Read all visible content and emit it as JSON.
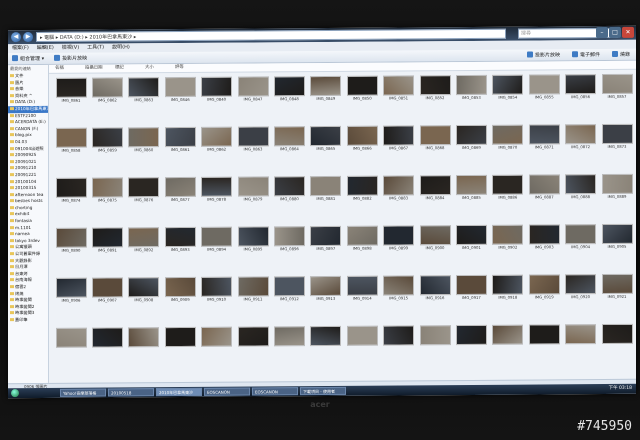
{
  "window": {
    "address": "▸ 電腦 ▸ DATA (D:) ▸ 2010年巴拿馬東沙 ▸",
    "search_placeholder": "搜尋"
  },
  "menu": [
    "檔案(F)",
    "編輯(E)",
    "檢視(V)",
    "工具(T)",
    "說明(H)"
  ],
  "toolbar": {
    "left": [
      "組合管理 ▾",
      "投影片放映"
    ],
    "right": [
      "投影片放映",
      "電子郵件",
      "燒錄"
    ]
  },
  "sidebar": {
    "header": "最愛的連結",
    "items": [
      "文件",
      "圖片",
      "音樂",
      "資料夾 ^",
      "DATA (D:)",
      "2010年巴拿馬東沙",
      "ESTF2100",
      "ACERDATA (E:)",
      "CANON (F:)",
      "blog.pix",
      "04.03",
      "091004出遊照",
      "20090925",
      "20091021",
      "20091210",
      "20091221",
      "20100104",
      "20100315",
      "afternoon tea",
      "besties hosts",
      "chorting",
      "exhibit",
      "fontasia",
      "m.1101",
      "narnea",
      "tokyo 3rdev",
      "公寓獵頭",
      "公司舊案件錄",
      "大觀錄影",
      "日月潭",
      "台東烤",
      "台南海報",
      "宿雲2",
      "烤燒",
      "時事變聞",
      "時事變聞2",
      "時事變聞3",
      "蓋印筆"
    ]
  },
  "columns": [
    "名稱",
    "拍攝日期",
    "標記",
    "大小",
    "評等"
  ],
  "thumbnails": {
    "rows": [
      [
        "IMG_0861",
        "IMG_0862",
        "IMG_0863",
        "IMG_0846",
        "IMG_0840",
        "IMG_0847",
        "IMG_0848",
        "IMG_0849",
        "IMG_0850",
        "IMG_0851",
        "IMG_0852",
        "IMG_0853",
        "IMG_0854",
        "IMG_0855",
        "IMG_0856",
        "IMG_0857"
      ],
      [
        "IMG_0858",
        "IMG_0859",
        "IMG_0860",
        "IMG_0861",
        "IMG_0862",
        "IMG_0863",
        "IMG_0864",
        "IMG_0865",
        "IMG_0866",
        "IMG_0867",
        "IMG_0868",
        "IMG_0869",
        "IMG_0870",
        "IMG_0871",
        "IMG_0872",
        "IMG_0873"
      ],
      [
        "IMG_0874",
        "IMG_0875",
        "IMG_0876",
        "IMG_0877",
        "IMG_0878",
        "IMG_0879",
        "IMG_0880",
        "IMG_0881",
        "IMG_0882",
        "IMG_0883",
        "IMG_0884",
        "IMG_0885",
        "IMG_0886",
        "IMG_0887",
        "IMG_0888",
        "IMG_0889"
      ],
      [
        "IMG_0890",
        "IMG_0891",
        "IMG_0892",
        "IMG_0893",
        "IMG_0894",
        "IMG_0895",
        "IMG_0896",
        "IMG_0897",
        "IMG_0898",
        "IMG_0899",
        "IMG_0900",
        "IMG_0901",
        "IMG_0902",
        "IMG_0903",
        "IMG_0904",
        "IMG_0905"
      ],
      [
        "IMG_0906",
        "IMG_0907",
        "IMG_0908",
        "IMG_0909",
        "IMG_0910",
        "IMG_0911",
        "IMG_0912",
        "IMG_0913",
        "IMG_0914",
        "IMG_0915",
        "IMG_0916",
        "IMG_0917",
        "IMG_0918",
        "IMG_0919",
        "IMG_0920",
        "IMG_0921"
      ],
      [
        "",
        "",
        "",
        "",
        "",
        "",
        "",
        "",
        "",
        "",
        "",
        "",
        "",
        "",
        "",
        ""
      ]
    ]
  },
  "status": "0906 張圖片",
  "taskbar": {
    "items": [
      "Yahoo!奇摩部落格",
      "20100518",
      "2010年巴拿馬東沙",
      "EOSCANON",
      "EOSCANON",
      "下載項目 - 使用者"
    ],
    "clock": "下午 03:18"
  },
  "watermark": "#745950",
  "colors": {
    "accent": "#3a78c8",
    "screen_bg": "#eef2f7"
  }
}
